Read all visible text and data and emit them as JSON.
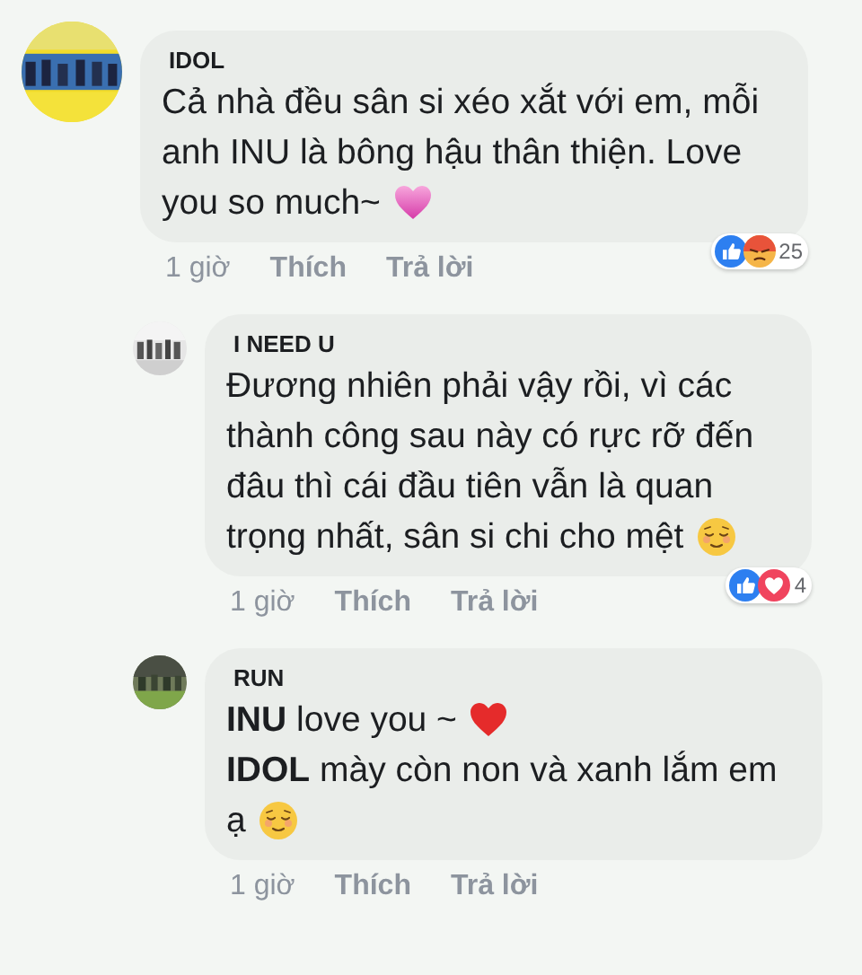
{
  "comments": [
    {
      "author": "IDOL",
      "lines": [
        {
          "kind": "plain",
          "text": "Cả nhà đều sân si xéo xắt với em, mỗi"
        },
        {
          "kind": "plain",
          "text": "anh INU là bông hậu thân thiện. Love"
        },
        {
          "kind": "pink-heart",
          "text": "you so much~"
        }
      ],
      "time": "1 giờ",
      "actions": [
        "Thích",
        "Trả lời"
      ],
      "reactions": {
        "items": [
          {
            "kind": "like"
          },
          {
            "kind": "angry"
          }
        ],
        "count": "25"
      },
      "children": [
        {
          "author": "I NEED U",
          "lines": [
            {
              "kind": "plain",
              "text": "Đương nhiên phải vậy rồi, vì các"
            },
            {
              "kind": "plain",
              "text": "thành công sau này có rực rỡ đến"
            },
            {
              "kind": "plain",
              "text": "đâu thì cái đầu tiên vẫn là quan"
            },
            {
              "kind": "relieved-face",
              "text": "trọng nhất, sân si chi cho mệt"
            }
          ],
          "time": "1 giờ",
          "actions": [
            "Thích",
            "Trả lời"
          ],
          "reactions": {
            "items": [
              {
                "kind": "like"
              },
              {
                "kind": "love"
              }
            ],
            "count": "4"
          }
        },
        {
          "author": "RUN",
          "lines": [
            {
              "kind": "red-heart",
              "text": "**INU** love you ~"
            },
            {
              "kind": "plain",
              "text": "**IDOL** mày còn non và xanh lắm em"
            },
            {
              "kind": "relieved-face",
              "text": "ạ"
            }
          ],
          "time": "1 giờ",
          "actions": [
            "Thích",
            "Trả lời"
          ]
        }
      ]
    }
  ]
}
